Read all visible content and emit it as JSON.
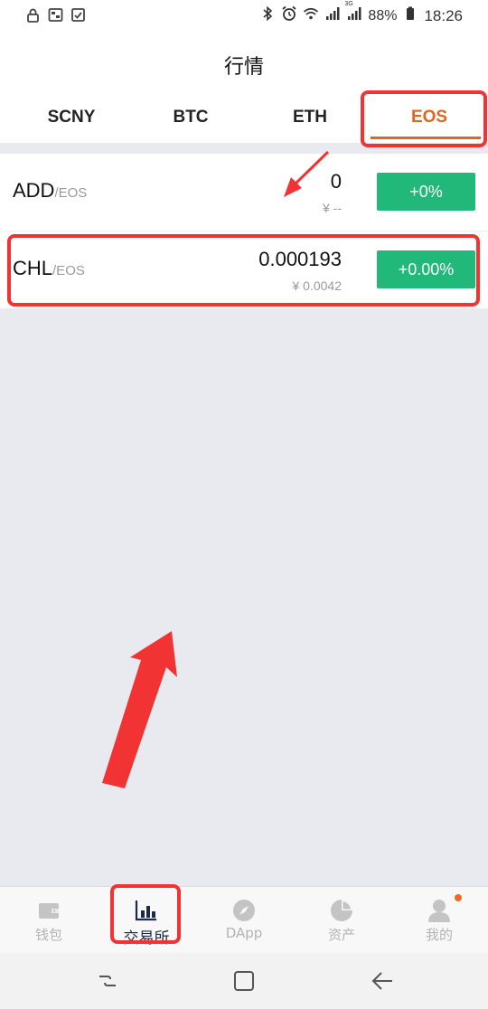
{
  "status_bar": {
    "battery": "88%",
    "time": "18:26",
    "network": "3G"
  },
  "header": {
    "title": "行情"
  },
  "tabs": [
    {
      "label": "SCNY",
      "active": false
    },
    {
      "label": "BTC",
      "active": false
    },
    {
      "label": "ETH",
      "active": false
    },
    {
      "label": "EOS",
      "active": true
    }
  ],
  "market": {
    "rows": [
      {
        "base": "ADD",
        "quote": "/EOS",
        "price": "0",
        "price_cny": "¥ --",
        "change": "+0%"
      },
      {
        "base": "CHL",
        "quote": "/EOS",
        "price": "0.000193",
        "price_cny": "¥ 0.0042",
        "change": "+0.00%"
      }
    ]
  },
  "bottom_nav": {
    "items": [
      {
        "label": "钱包",
        "icon": "wallet-icon",
        "active": false
      },
      {
        "label": "交易所",
        "icon": "exchange-chart-icon",
        "active": true
      },
      {
        "label": "DApp",
        "icon": "compass-icon",
        "active": false
      },
      {
        "label": "资产",
        "icon": "pie-chart-icon",
        "active": false
      },
      {
        "label": "我的",
        "icon": "user-icon",
        "active": false,
        "badge_dot": true
      }
    ]
  },
  "colors": {
    "accent": "#e0651f",
    "up": "#22b879",
    "annotation": "#f23333",
    "nav_active": "#1c2a48",
    "background": "#e8eaf0"
  }
}
